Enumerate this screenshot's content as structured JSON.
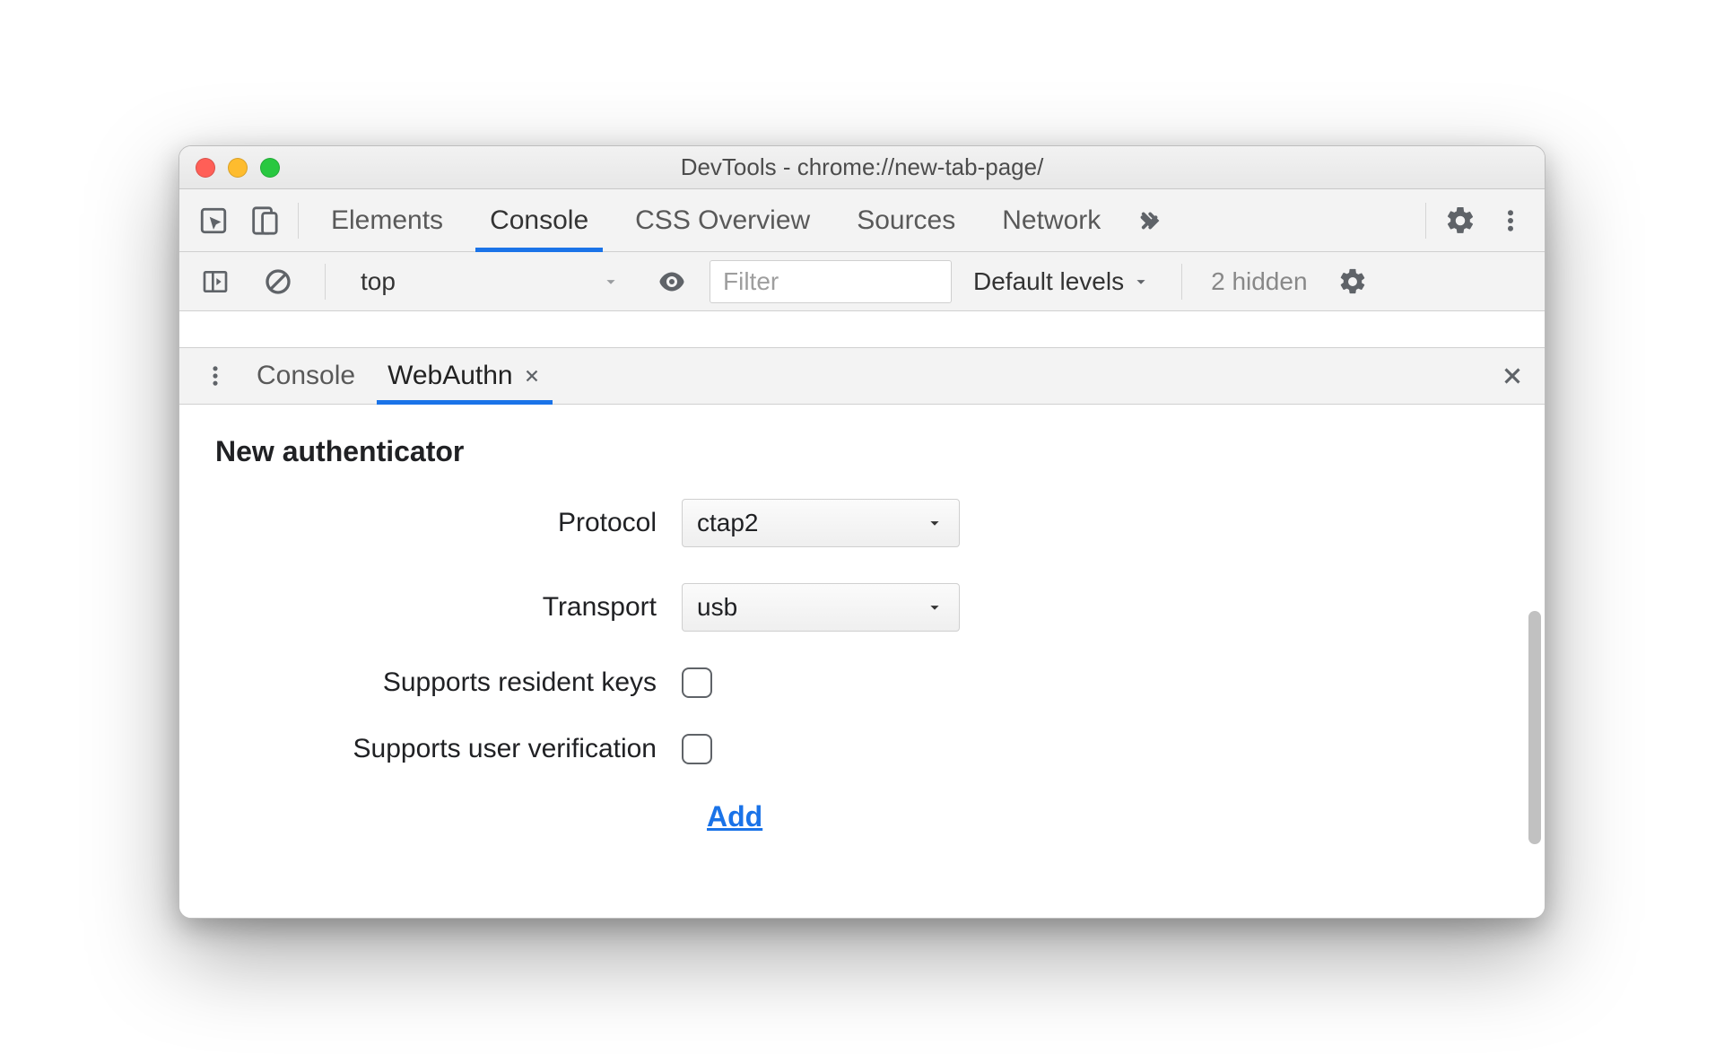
{
  "window": {
    "title": "DevTools - chrome://new-tab-page/"
  },
  "mainTabs": {
    "elements": "Elements",
    "console": "Console",
    "cssOverview": "CSS Overview",
    "sources": "Sources",
    "network": "Network"
  },
  "consoleToolbar": {
    "context": "top",
    "filterPlaceholder": "Filter",
    "levels": "Default levels",
    "hidden": "2 hidden"
  },
  "drawerTabs": {
    "console": "Console",
    "webauthn": "WebAuthn"
  },
  "panel": {
    "heading": "New authenticator",
    "protocolLabel": "Protocol",
    "protocolValue": "ctap2",
    "transportLabel": "Transport",
    "transportValue": "usb",
    "residentKeysLabel": "Supports resident keys",
    "userVerificationLabel": "Supports user verification",
    "addLabel": "Add"
  }
}
